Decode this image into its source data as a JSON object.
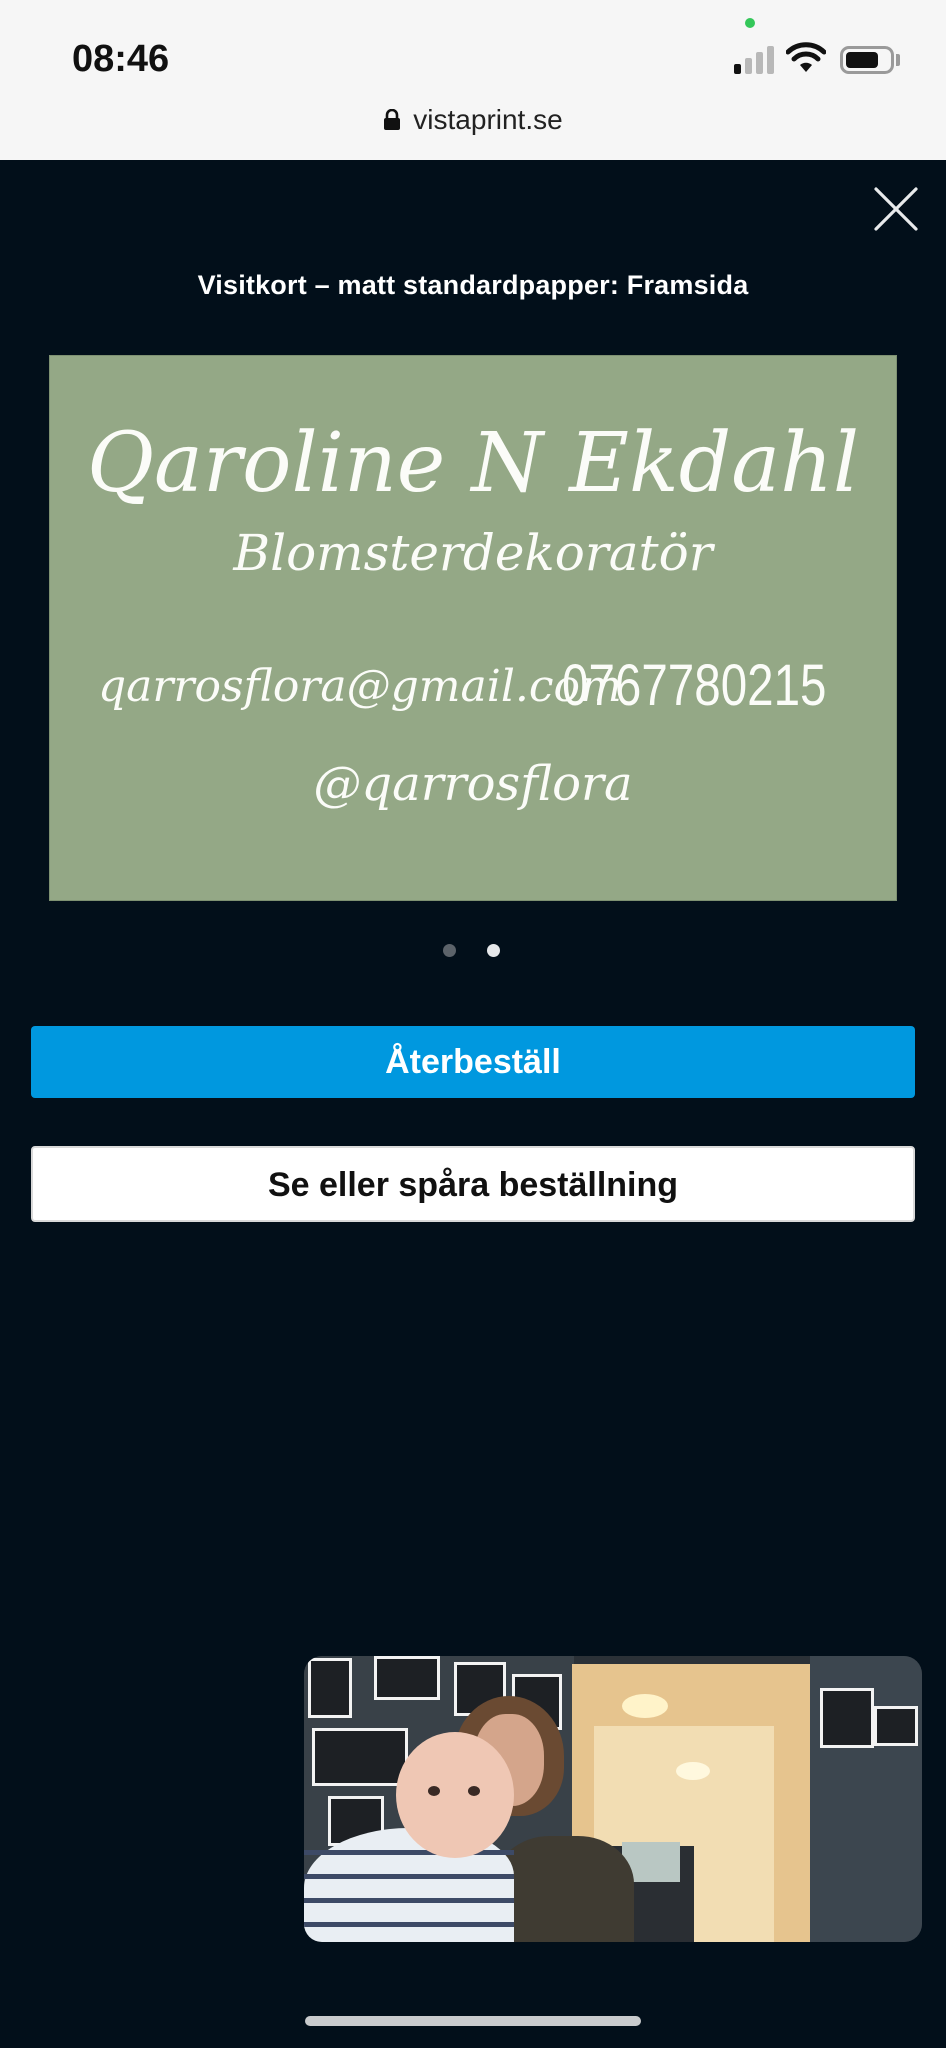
{
  "status_bar": {
    "time": "08:46",
    "signal_bars_active": 1,
    "signal_bars_total": 4,
    "battery_level": 0.8,
    "camera_indicator_color": "#34c759"
  },
  "browser": {
    "url": "vistaprint.se"
  },
  "modal": {
    "title": "Visitkort – matt standardpapper: Framsida",
    "close_icon": "close-icon"
  },
  "business_card": {
    "background_color": "#94a886",
    "name": "Qaroline N Ekdahl",
    "role": "Blomsterdekoratör",
    "email": "qarrosflora@gmail.com",
    "phone": "0767780215",
    "social_handle": "@qarrosflora"
  },
  "carousel": {
    "pages": 2,
    "active_page": 2
  },
  "actions": {
    "reorder_label": "Återbeställ",
    "reorder_color": "#0098df",
    "track_label": "Se eller spåra beställning"
  },
  "pip_video": {
    "icon": "video-thumbnail"
  }
}
